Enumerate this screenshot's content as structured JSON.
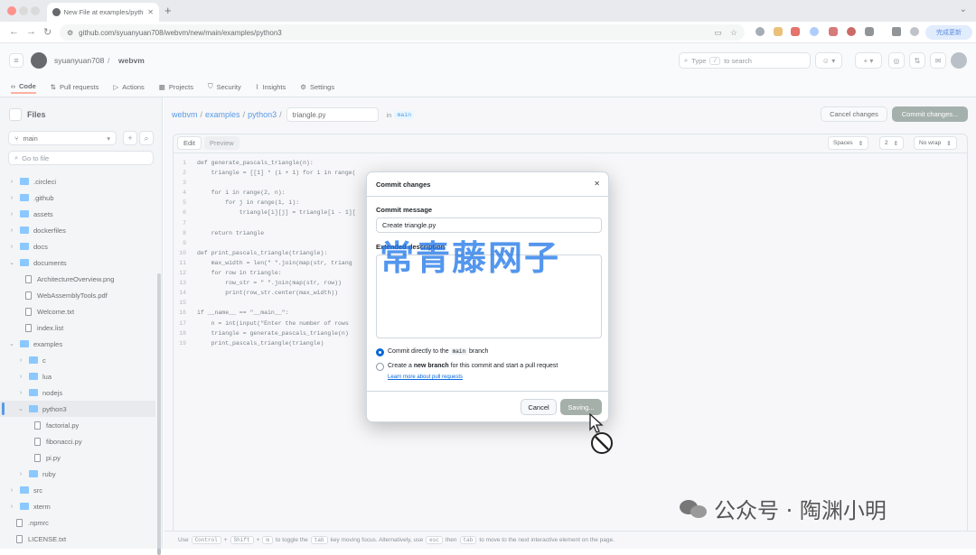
{
  "browser": {
    "tab_title": "New File at examples/python3",
    "url": "github.com/syuanyuan708/webvm/new/main/examples/python3",
    "update_button": "完成更新"
  },
  "header": {
    "owner": "syuanyuan708",
    "repo": "webvm",
    "search_prefix": "Type",
    "search_key": "/",
    "search_suffix": "to search"
  },
  "repo_tabs": [
    {
      "label": "Code"
    },
    {
      "label": "Pull requests"
    },
    {
      "label": "Actions"
    },
    {
      "label": "Projects"
    },
    {
      "label": "Security"
    },
    {
      "label": "Insights"
    },
    {
      "label": "Settings"
    }
  ],
  "sidebar": {
    "title": "Files",
    "branch": "main",
    "goto_placeholder": "Go to file",
    "tree": [
      {
        "label": ".circleci",
        "type": "folder",
        "depth": 0,
        "open": false
      },
      {
        "label": ".github",
        "type": "folder",
        "depth": 0,
        "open": false
      },
      {
        "label": "assets",
        "type": "folder",
        "depth": 0,
        "open": false
      },
      {
        "label": "dockerfiles",
        "type": "folder",
        "depth": 0,
        "open": false
      },
      {
        "label": "docs",
        "type": "folder",
        "depth": 0,
        "open": false
      },
      {
        "label": "documents",
        "type": "folder",
        "depth": 0,
        "open": true
      },
      {
        "label": "ArchitectureOverview.png",
        "type": "file",
        "depth": 1
      },
      {
        "label": "WebAssemblyTools.pdf",
        "type": "file",
        "depth": 1
      },
      {
        "label": "Welcome.txt",
        "type": "file",
        "depth": 1
      },
      {
        "label": "index.list",
        "type": "file",
        "depth": 1
      },
      {
        "label": "examples",
        "type": "folder",
        "depth": 0,
        "open": true
      },
      {
        "label": "c",
        "type": "folder",
        "depth": 1,
        "open": false
      },
      {
        "label": "lua",
        "type": "folder",
        "depth": 1,
        "open": false
      },
      {
        "label": "nodejs",
        "type": "folder",
        "depth": 1,
        "open": false
      },
      {
        "label": "python3",
        "type": "folder",
        "depth": 1,
        "open": true,
        "selected": true
      },
      {
        "label": "factorial.py",
        "type": "file",
        "depth": 2
      },
      {
        "label": "fibonacci.py",
        "type": "file",
        "depth": 2
      },
      {
        "label": "pi.py",
        "type": "file",
        "depth": 2
      },
      {
        "label": "ruby",
        "type": "folder",
        "depth": 1,
        "open": false
      },
      {
        "label": "src",
        "type": "folder",
        "depth": 0,
        "open": false
      },
      {
        "label": "xterm",
        "type": "folder",
        "depth": 0,
        "open": false
      },
      {
        "label": ".npmrc",
        "type": "file",
        "depth": 0
      },
      {
        "label": "LICENSE.txt",
        "type": "file",
        "depth": 0
      }
    ]
  },
  "editor": {
    "crumbs": [
      "webvm",
      "examples",
      "python3"
    ],
    "filename": "triangle.py",
    "in_label": "in",
    "branch": "main",
    "cancel_label": "Cancel changes",
    "commit_label": "Commit changes...",
    "tab_edit": "Edit",
    "tab_preview": "Preview",
    "indent_mode": "Spaces",
    "indent_size": "2",
    "wrap": "No wrap",
    "lines": [
      "def generate_pascals_triangle(n):",
      "    triangle = [[1] * (i + 1) for i in range(",
      "",
      "    for i in range(2, n):",
      "        for j in range(1, i):",
      "            triangle[i][j] = triangle[i - 1][",
      "",
      "    return triangle",
      "",
      "def print_pascals_triangle(triangle):",
      "    max_width = len(\" \".join(map(str, triang",
      "    for row in triangle:",
      "        row_str = \" \".join(map(str, row))",
      "        print(row_str.center(max_width))",
      "",
      "if __name__ == \"__main__\":",
      "    n = int(input(\"Enter the number of rows",
      "    triangle = generate_pascals_triangle(n)",
      "    print_pascals_triangle(triangle)"
    ]
  },
  "status_bar": {
    "use": "Use",
    "k1": "Control",
    "plus1": "+",
    "k2": "Shift",
    "plus2": "+",
    "k3": "m",
    "t1": "to toggle the",
    "k4": "tab",
    "t2": "key moving focus. Alternatively, use",
    "k5": "esc",
    "t3": "then",
    "k6": "tab",
    "t4": "to move to the next interactive element on the page."
  },
  "dialog": {
    "title": "Commit changes",
    "message_label": "Commit message",
    "message_value": "Create triangle.py",
    "description_label": "Extended description",
    "radio1_prefix": "Commit directly to the",
    "radio1_branch": "main",
    "radio1_suffix": "branch",
    "radio2_prefix": "Create a",
    "radio2_bold": "new branch",
    "radio2_suffix": "for this commit and start a pull request",
    "learn_more": "Learn more about pull requests",
    "cancel": "Cancel",
    "saving": "Saving..."
  },
  "watermarks": {
    "center": "常青藤网子",
    "bottom": "公众号 · 陶渊小明"
  },
  "colors": {
    "primary_link": "#0969da",
    "commit_button": "#7a8b85",
    "saving_button": "#a6b0ab",
    "folder": "#54aeff"
  }
}
